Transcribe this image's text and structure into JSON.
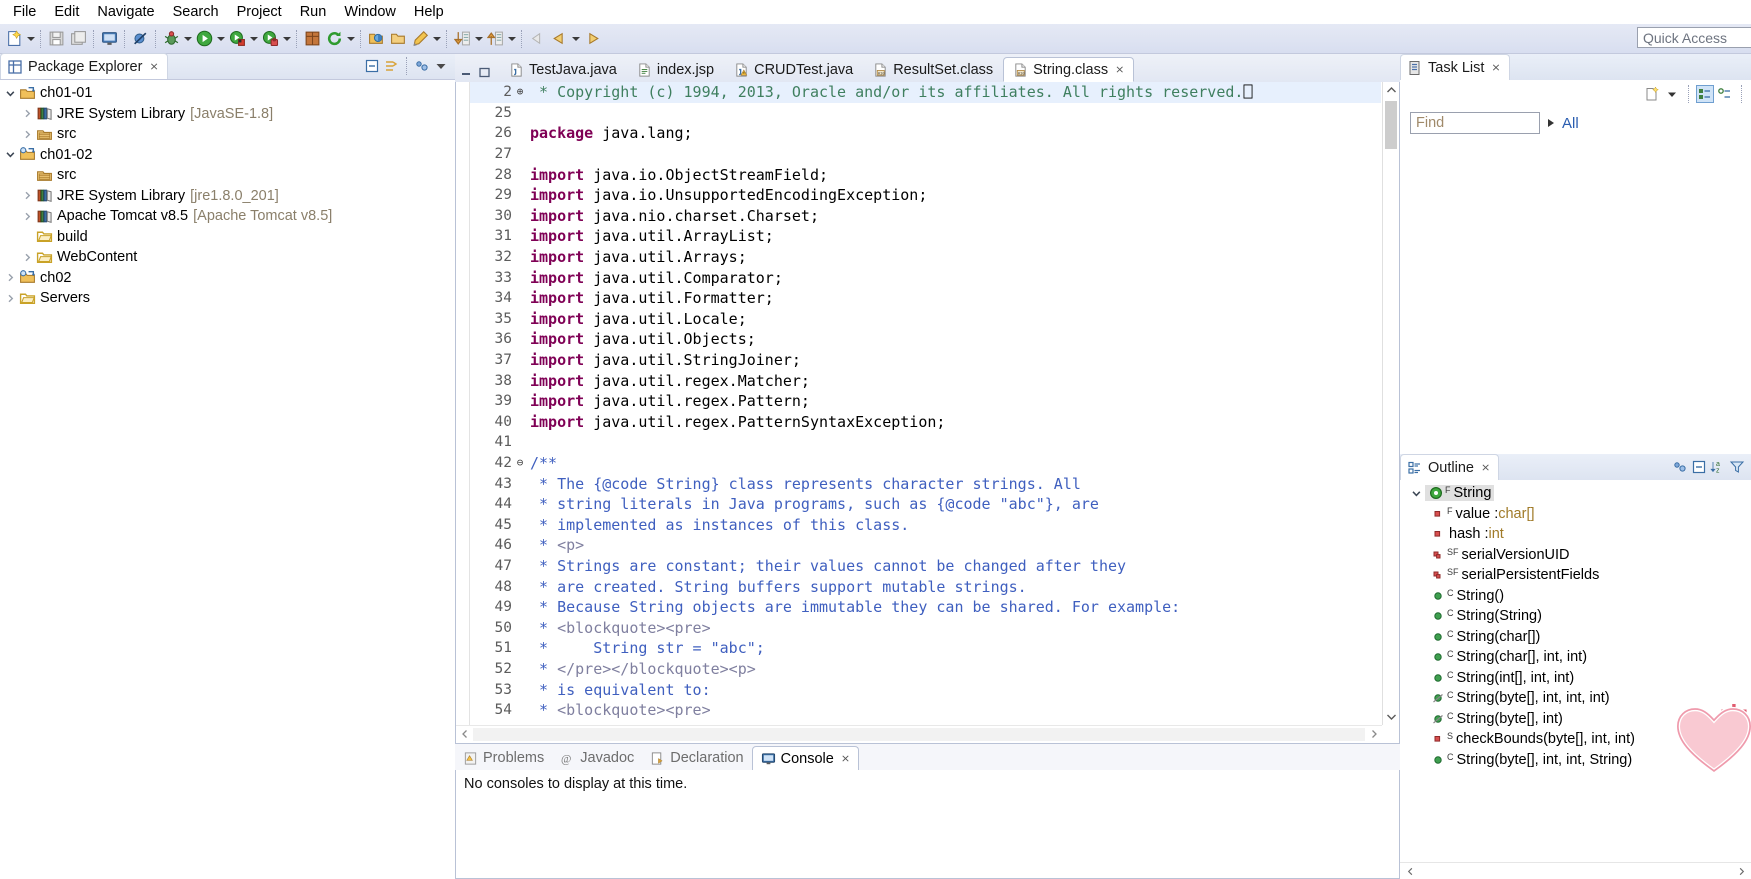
{
  "menu": {
    "items": [
      "File",
      "Edit",
      "Navigate",
      "Search",
      "Project",
      "Run",
      "Window",
      "Help"
    ]
  },
  "toolbar": {
    "quick_access_placeholder": "Quick Access",
    "icons": [
      "new-file-icon",
      "save-icon",
      "save-all-icon",
      "console-icon",
      "skip-breakpoints-icon",
      "debug-icon",
      "run-icon",
      "coverage-icon",
      "external-tools-icon",
      "new-package-icon",
      "refresh-icon",
      "open-type-icon",
      "open-task-icon",
      "edit-icon",
      "next-annotation-icon",
      "previous-annotation-icon",
      "back-icon",
      "forward-icon"
    ]
  },
  "package_explorer": {
    "title": "Package Explorer",
    "close_label": "⨯",
    "tools": [
      "collapse-all-icon",
      "link-with-editor-icon",
      "view-menu-icon",
      "view-chevron-icon"
    ],
    "tree": [
      {
        "label": "ch01-01",
        "sub": "",
        "indent": 0,
        "twisty": "down",
        "icon": "java-project-icon"
      },
      {
        "label": "JRE System Library",
        "sub": "[JavaSE-1.8]",
        "indent": 1,
        "twisty": "right",
        "icon": "library-icon"
      },
      {
        "label": "src",
        "sub": "",
        "indent": 1,
        "twisty": "right",
        "icon": "source-folder-icon"
      },
      {
        "label": "ch01-02",
        "sub": "",
        "indent": 0,
        "twisty": "down",
        "icon": "web-project-icon"
      },
      {
        "label": "src",
        "sub": "",
        "indent": 1,
        "twisty": "none",
        "icon": "source-folder-icon"
      },
      {
        "label": "JRE System Library",
        "sub": "[jre1.8.0_201]",
        "indent": 1,
        "twisty": "right",
        "icon": "library-icon"
      },
      {
        "label": "Apache Tomcat v8.5",
        "sub": "[Apache Tomcat v8.5]",
        "indent": 1,
        "twisty": "right",
        "icon": "library-icon"
      },
      {
        "label": "build",
        "sub": "",
        "indent": 1,
        "twisty": "none",
        "icon": "folder-icon"
      },
      {
        "label": "WebContent",
        "sub": "",
        "indent": 1,
        "twisty": "right",
        "icon": "folder-icon"
      },
      {
        "label": "ch02",
        "sub": "",
        "indent": 0,
        "twisty": "right",
        "icon": "web-project-icon"
      },
      {
        "label": "Servers",
        "sub": "",
        "indent": 0,
        "twisty": "right",
        "icon": "folder-icon"
      }
    ]
  },
  "editor": {
    "tabs": [
      {
        "label": "TestJava.java",
        "icon": "java-file-icon",
        "active": false,
        "closable": false
      },
      {
        "label": "index.jsp",
        "icon": "jsp-file-icon",
        "active": false,
        "closable": false
      },
      {
        "label": "CRUDTest.java",
        "icon": "java-warning-file-icon",
        "active": false,
        "closable": false
      },
      {
        "label": "ResultSet.class",
        "icon": "class-file-icon",
        "active": false,
        "closable": false
      },
      {
        "label": "String.class",
        "icon": "class-file-icon",
        "active": true,
        "closable": true
      }
    ],
    "close_label": "⨯",
    "minimize_label": "minimize-icon",
    "maximize_label": "maximize-icon",
    "lines": [
      {
        "n": "2",
        "fold": "⊕",
        "hl": true,
        "segs": [
          {
            "t": " * Copyright (c) 1994, 2013, Oracle and/or its affiliates. All rights reserved.",
            "c": "cm"
          },
          {
            "t": "⎕",
            "c": "pl"
          }
        ]
      },
      {
        "n": "25",
        "fold": "",
        "hl": false,
        "segs": []
      },
      {
        "n": "26",
        "fold": "",
        "hl": false,
        "segs": [
          {
            "t": "package",
            "c": "k"
          },
          {
            "t": " java.lang;",
            "c": "pl"
          }
        ]
      },
      {
        "n": "27",
        "fold": "",
        "hl": false,
        "segs": []
      },
      {
        "n": "28",
        "fold": "",
        "hl": false,
        "segs": [
          {
            "t": "import",
            "c": "k"
          },
          {
            "t": " java.io.ObjectStreamField;",
            "c": "pl"
          }
        ]
      },
      {
        "n": "29",
        "fold": "",
        "hl": false,
        "segs": [
          {
            "t": "import",
            "c": "k"
          },
          {
            "t": " java.io.UnsupportedEncodingException;",
            "c": "pl"
          }
        ]
      },
      {
        "n": "30",
        "fold": "",
        "hl": false,
        "segs": [
          {
            "t": "import",
            "c": "k"
          },
          {
            "t": " java.nio.charset.Charset;",
            "c": "pl"
          }
        ]
      },
      {
        "n": "31",
        "fold": "",
        "hl": false,
        "segs": [
          {
            "t": "import",
            "c": "k"
          },
          {
            "t": " java.util.ArrayList;",
            "c": "pl"
          }
        ]
      },
      {
        "n": "32",
        "fold": "",
        "hl": false,
        "segs": [
          {
            "t": "import",
            "c": "k"
          },
          {
            "t": " java.util.Arrays;",
            "c": "pl"
          }
        ]
      },
      {
        "n": "33",
        "fold": "",
        "hl": false,
        "segs": [
          {
            "t": "import",
            "c": "k"
          },
          {
            "t": " java.util.Comparator;",
            "c": "pl"
          }
        ]
      },
      {
        "n": "34",
        "fold": "",
        "hl": false,
        "segs": [
          {
            "t": "import",
            "c": "k"
          },
          {
            "t": " java.util.Formatter;",
            "c": "pl"
          }
        ]
      },
      {
        "n": "35",
        "fold": "",
        "hl": false,
        "segs": [
          {
            "t": "import",
            "c": "k"
          },
          {
            "t": " java.util.Locale;",
            "c": "pl"
          }
        ]
      },
      {
        "n": "36",
        "fold": "",
        "hl": false,
        "segs": [
          {
            "t": "import",
            "c": "k"
          },
          {
            "t": " java.util.Objects;",
            "c": "pl"
          }
        ]
      },
      {
        "n": "37",
        "fold": "",
        "hl": false,
        "segs": [
          {
            "t": "import",
            "c": "k"
          },
          {
            "t": " java.util.StringJoiner;",
            "c": "pl"
          }
        ]
      },
      {
        "n": "38",
        "fold": "",
        "hl": false,
        "segs": [
          {
            "t": "import",
            "c": "k"
          },
          {
            "t": " java.util.regex.Matcher;",
            "c": "pl"
          }
        ]
      },
      {
        "n": "39",
        "fold": "",
        "hl": false,
        "segs": [
          {
            "t": "import",
            "c": "k"
          },
          {
            "t": " java.util.regex.Pattern;",
            "c": "pl"
          }
        ]
      },
      {
        "n": "40",
        "fold": "",
        "hl": false,
        "segs": [
          {
            "t": "import",
            "c": "k"
          },
          {
            "t": " java.util.regex.PatternSyntaxException;",
            "c": "pl"
          }
        ]
      },
      {
        "n": "41",
        "fold": "",
        "hl": false,
        "segs": []
      },
      {
        "n": "42",
        "fold": "⊖",
        "hl": false,
        "segs": [
          {
            "t": "/**",
            "c": "jd"
          }
        ]
      },
      {
        "n": "43",
        "fold": "",
        "hl": false,
        "segs": [
          {
            "t": " * The {@code String} class represents character strings. All",
            "c": "jd"
          }
        ]
      },
      {
        "n": "44",
        "fold": "",
        "hl": false,
        "segs": [
          {
            "t": " * string literals in Java programs, such as {@code \"abc\"}, are",
            "c": "jd"
          }
        ]
      },
      {
        "n": "45",
        "fold": "",
        "hl": false,
        "segs": [
          {
            "t": " * implemented as instances of this class.",
            "c": "jd"
          }
        ]
      },
      {
        "n": "46",
        "fold": "",
        "hl": false,
        "segs": [
          {
            "t": " * ",
            "c": "jd"
          },
          {
            "t": "<p>",
            "c": "jt"
          }
        ]
      },
      {
        "n": "47",
        "fold": "",
        "hl": false,
        "segs": [
          {
            "t": " * Strings are constant; their values cannot be changed after they",
            "c": "jd"
          }
        ]
      },
      {
        "n": "48",
        "fold": "",
        "hl": false,
        "segs": [
          {
            "t": " * are created. String buffers support mutable strings.",
            "c": "jd"
          }
        ]
      },
      {
        "n": "49",
        "fold": "",
        "hl": false,
        "segs": [
          {
            "t": " * Because String objects are immutable they can be shared. For example:",
            "c": "jd"
          }
        ]
      },
      {
        "n": "50",
        "fold": "",
        "hl": false,
        "segs": [
          {
            "t": " * ",
            "c": "jd"
          },
          {
            "t": "<blockquote><pre>",
            "c": "jt"
          }
        ]
      },
      {
        "n": "51",
        "fold": "",
        "hl": false,
        "segs": [
          {
            "t": " *     String str = \"abc\";",
            "c": "jd"
          }
        ]
      },
      {
        "n": "52",
        "fold": "",
        "hl": false,
        "segs": [
          {
            "t": " * ",
            "c": "jd"
          },
          {
            "t": "</pre></blockquote><p>",
            "c": "jt"
          }
        ]
      },
      {
        "n": "53",
        "fold": "",
        "hl": false,
        "segs": [
          {
            "t": " * is equivalent to:",
            "c": "jd"
          }
        ]
      },
      {
        "n": "54",
        "fold": "",
        "hl": false,
        "segs": [
          {
            "t": " * ",
            "c": "jd"
          },
          {
            "t": "<blockquote><pre>",
            "c": "jt"
          }
        ]
      }
    ]
  },
  "bottom_panel": {
    "tabs": [
      {
        "label": "Problems",
        "icon": "problems-icon",
        "active": false
      },
      {
        "label": "Javadoc",
        "icon": "javadoc-icon",
        "active": false
      },
      {
        "label": "Declaration",
        "icon": "declaration-icon",
        "active": false
      },
      {
        "label": "Console",
        "icon": "console-icon",
        "active": true
      }
    ],
    "close_label": "⨯",
    "message": "No consoles to display at this time."
  },
  "task_list": {
    "title": "Task List",
    "close_label": "⨯",
    "tools": [
      "new-task-icon",
      "task-menu-arrow",
      "categorize-icon",
      "filter-icon"
    ],
    "find_placeholder": "Find",
    "all_label": "All"
  },
  "outline": {
    "title": "Outline",
    "close_label": "⨯",
    "tools": [
      "focus-icon",
      "collapse-all-icon",
      "sort-icon",
      "filter-icon"
    ],
    "items": [
      {
        "label": "String",
        "type": "",
        "icon": "class-icon",
        "modifier": "F",
        "indent": 0,
        "twisty": "down",
        "selected": true
      },
      {
        "label": "value : ",
        "type": "char[]",
        "icon": "field-private-icon",
        "modifier": "F",
        "indent": 1,
        "twisty": "none",
        "selected": false
      },
      {
        "label": "hash : ",
        "type": "int",
        "icon": "field-private-icon",
        "modifier": "",
        "indent": 1,
        "twisty": "none",
        "selected": false
      },
      {
        "label": "serialVersionUID",
        "type": "",
        "icon": "field-private-static-icon",
        "modifier": "SF",
        "indent": 1,
        "twisty": "none",
        "selected": false
      },
      {
        "label": "serialPersistentFields",
        "type": "",
        "icon": "field-private-static-icon",
        "modifier": "SF",
        "indent": 1,
        "twisty": "none",
        "selected": false
      },
      {
        "label": "String()",
        "type": "",
        "icon": "method-public-icon",
        "modifier": "C",
        "indent": 1,
        "twisty": "none",
        "selected": false
      },
      {
        "label": "String(String)",
        "type": "",
        "icon": "method-public-icon",
        "modifier": "C",
        "indent": 1,
        "twisty": "none",
        "selected": false
      },
      {
        "label": "String(char[])",
        "type": "",
        "icon": "method-public-icon",
        "modifier": "C",
        "indent": 1,
        "twisty": "none",
        "selected": false
      },
      {
        "label": "String(char[], int, int)",
        "type": "",
        "icon": "method-public-icon",
        "modifier": "C",
        "indent": 1,
        "twisty": "none",
        "selected": false
      },
      {
        "label": "String(int[], int, int)",
        "type": "",
        "icon": "method-public-icon",
        "modifier": "C",
        "indent": 1,
        "twisty": "none",
        "selected": false
      },
      {
        "label": "String(byte[], int, int, int)",
        "type": "",
        "icon": "method-deprecated-icon",
        "modifier": "C",
        "indent": 1,
        "twisty": "none",
        "selected": false
      },
      {
        "label": "String(byte[], int)",
        "type": "",
        "icon": "method-deprecated-icon",
        "modifier": "C",
        "indent": 1,
        "twisty": "none",
        "selected": false
      },
      {
        "label": "checkBounds(byte[], int, int)",
        "type": "",
        "icon": "method-private-static-icon",
        "modifier": "S",
        "indent": 1,
        "twisty": "none",
        "selected": false
      },
      {
        "label": "String(byte[], int, int, String)",
        "type": "",
        "icon": "method-public-icon",
        "modifier": "C",
        "indent": 1,
        "twisty": "none",
        "selected": false
      }
    ]
  }
}
